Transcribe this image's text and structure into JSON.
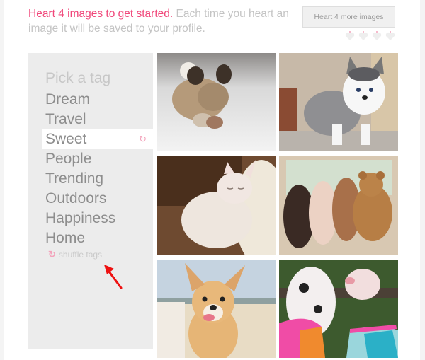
{
  "intro": {
    "highlight": "Heart 4 images to get started.",
    "text": " Each time you heart an image it will be saved to your profile."
  },
  "more_button": {
    "label": "Heart 4 more images"
  },
  "hearts": {
    "total": 4,
    "filled": 0,
    "icon": "heart-icon"
  },
  "sidebar": {
    "heading": "Pick a tag",
    "tags": [
      {
        "label": "Dream",
        "active": false
      },
      {
        "label": "Travel",
        "active": false
      },
      {
        "label": "Sweet",
        "active": true
      },
      {
        "label": "People",
        "active": false
      },
      {
        "label": "Trending",
        "active": false
      },
      {
        "label": "Outdoors",
        "active": false
      },
      {
        "label": "Happiness",
        "active": false
      },
      {
        "label": "Home",
        "active": false
      }
    ],
    "active_icon": "↻",
    "shuffle_icon": "↻",
    "shuffle_label": "shuffle tags"
  },
  "images": [
    {
      "name": "shih-tzu-jumping-in-snow"
    },
    {
      "name": "husky-puppy"
    },
    {
      "name": "sleeping-white-kitten"
    },
    {
      "name": "puppies-sleeping-with-teddy-bear"
    },
    {
      "name": "corgi-puppy-on-beach"
    },
    {
      "name": "piglets-in-tutus"
    }
  ],
  "colors": {
    "accent": "#f0477a",
    "sidebar_bg": "#ececec",
    "annotation_arrow": "#ee1111"
  }
}
